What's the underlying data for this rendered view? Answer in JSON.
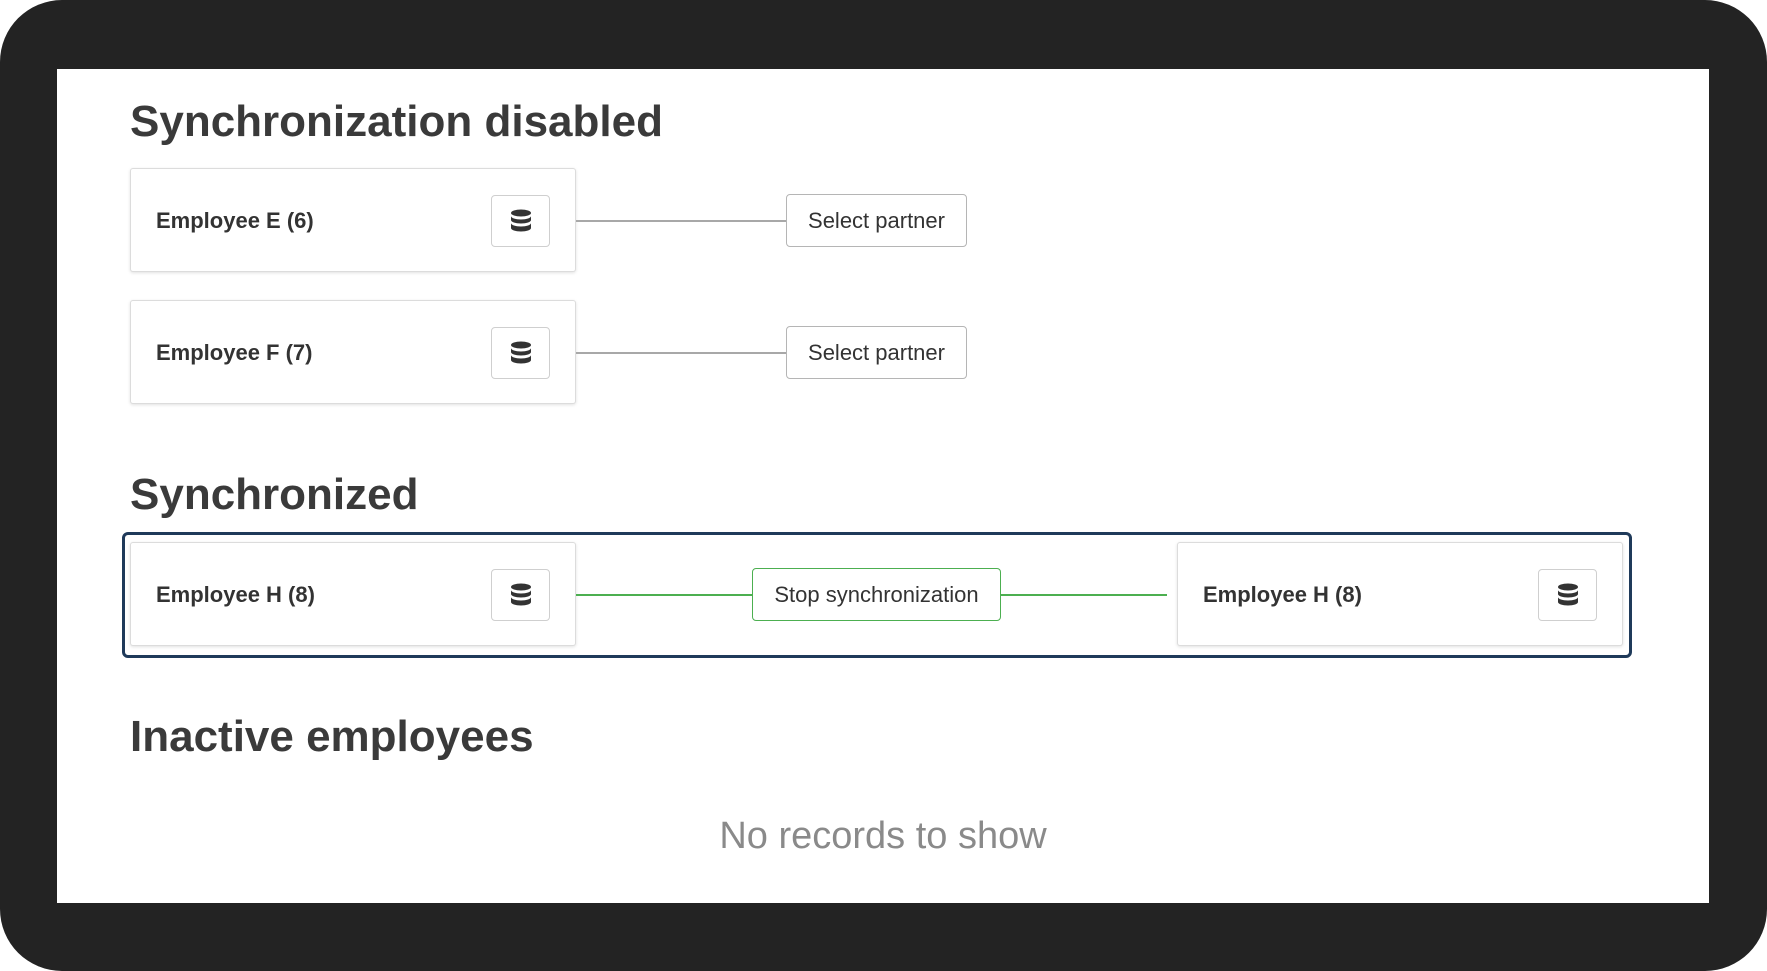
{
  "sections": {
    "disabled": {
      "title": "Synchronization disabled",
      "rows": [
        {
          "employee": "Employee E (6)",
          "action": "Select partner"
        },
        {
          "employee": "Employee F (7)",
          "action": "Select partner"
        }
      ]
    },
    "synchronized": {
      "title": "Synchronized",
      "rows": [
        {
          "employee": "Employee H (8)",
          "action": "Stop synchronization",
          "partner": "Employee H (8)"
        }
      ]
    },
    "inactive": {
      "title": "Inactive employees",
      "empty_text": "No records to show"
    }
  },
  "icons": {
    "database": "database-icon"
  },
  "colors": {
    "sync_line": "#4caf50",
    "selected_border": "#1f3a5a",
    "idle_line": "#a8a8a8"
  }
}
